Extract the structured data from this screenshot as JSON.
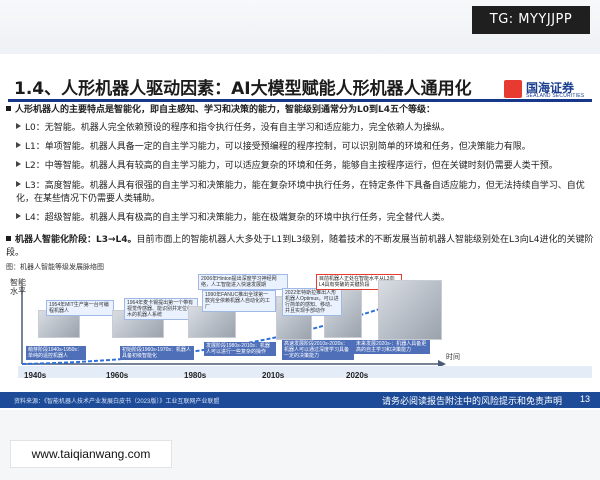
{
  "tag": "TG: MYYJJPP",
  "title": "1.4、人形机器人驱动因素：AI大模型赋能人形机器人通用化",
  "logo": {
    "cn": "国海证券",
    "en": "SEALAND SECURITIES"
  },
  "intro": "人形机器人的主要特点是智能化，即自主感知、学习和决策的能力，智能级别通常分为L0到L4五个等级：",
  "levels": [
    "L0：无智能。机器人完全依赖预设的程序和指令执行任务，没有自主学习和适应能力，完全依赖人为操纵。",
    "L1：单项智能。机器人具备一定的自主学习能力，可以接受预编程的程序控制，可以识别简单的环境和任务，但决策能力有限。",
    "L2：中等智能。机器人具有较高的自主学习能力，可以适应复杂的环境和任务，能够自主按程序运行，但在关键时刻仍需要人类干预。",
    "L3：高度智能。机器人具有很强的自主学习和决策能力，能在复杂环境中执行任务，在特定条件下具备自适应能力，但无法持续自学习、自优化，在某些情况下仍需要人类辅助。",
    "L4：超级智能。机器人具有极高的自主学习和决策能力，能在极端复杂的环境中执行任务，完全替代人类。"
  ],
  "stage_label": "机器人智能化阶段：L3→L4。",
  "stage_text": "目前市面上的智能机器人大多处于L1到L3级别，随着技术的不断发展当前机器人智能级别处在L3向L4进化的关键阶段。",
  "figure_caption": "图：机器人智能等级发展脉络图",
  "figure": {
    "y_axis": "智能水平",
    "x_axis": "时间",
    "eras": [
      "1940s",
      "1960s",
      "1980s",
      "2010s",
      "2020s"
    ],
    "notes": [
      "1954年MIT生产第一台可编程机器人",
      "1964年麦卡锡提出第一个带有视觉传感器、能识别并定位积木的机器人系统",
      "1990年FANUC推出全球第一款完全依赖机器人自动化的工厂",
      "2006年Hinton提出深度学习神经网络，人工智能进入快速发展期",
      "2022年特斯拉推出人形机器人Optimus，可以进行简单的感知、移动、并且实现手部动作",
      "目前机器人正处在智能水平从L3向L4具有突破的关键阶段"
    ],
    "stages": [
      "萌芽阶段1940s-1950s：单纯的遥控机器人",
      "初始阶段1960s-1970s：机器人具备初级智能化",
      "发展阶段1980s-2010s：机器人可以进行一些复杂的操作",
      "高速发展阶段2010s-2020s：机器人可以通过深度学习具备一定的决策能力",
      "未来发展2020s-：机器人具备更高的自主学习和决策能力"
    ]
  },
  "footer": {
    "source": "资料来源：《智能机器人技术产业发展白皮书（2023版）》工业互联网产业联盟",
    "disclaimer": "请务必阅读报告附注中的风险提示和免责声明",
    "page": "13"
  },
  "watermark": "www.taiqianwang.com",
  "colors": {
    "accent": "#16378a",
    "footer": "#1d4b98",
    "logo_red": "#e73a31"
  }
}
